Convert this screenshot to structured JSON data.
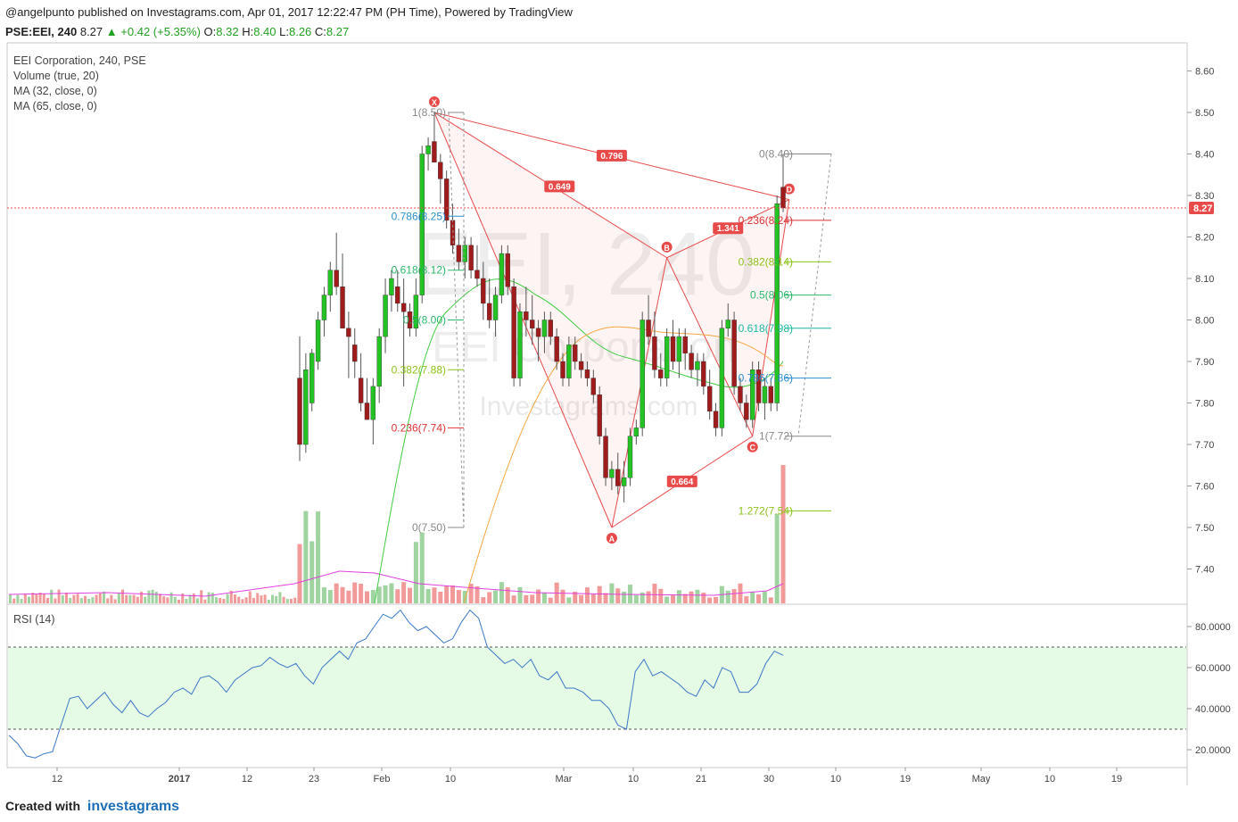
{
  "header": {
    "published": "@angelpunto published on Investagrams.com, Apr 01, 2017 12:22:47 PM (PH Time), Powered by TradingView",
    "symbol": "PSE:EEI, 240",
    "last": "8.27",
    "change": "+0.42 (+5.35%)",
    "o_label": "O:",
    "o": "8.32",
    "h_label": "H:",
    "h": "8.40",
    "l_label": "L:",
    "l": "8.26",
    "c_label": "C:",
    "c": "8.27"
  },
  "legend": {
    "title": "EEI Corporation, 240, PSE",
    "volume": "Volume (true, 20)",
    "ma32": "MA (32, close, 0)",
    "ma65": "MA (65, close, 0)",
    "rsi": "RSI (14)"
  },
  "watermark": {
    "symbol": "EEI, 240",
    "name": "EEI Corporation",
    "site": "Investagrams.com"
  },
  "footer": {
    "created": "Created with",
    "brand": "investagrams"
  },
  "colors": {
    "up": "#22c322",
    "down": "#a01c1c",
    "vol_up": "#9fd39f",
    "vol_down": "#f29a9a",
    "ma32": "#44cc44",
    "ma65": "#f5a742",
    "vol_ma": "#e040e0",
    "pattern": "#e84a4a",
    "rsi": "#3a78c8",
    "rsi_band": "#e6fbe6"
  },
  "chart_data": {
    "type": "candlestick",
    "price_axis": {
      "ticks": [
        "8.60",
        "8.50",
        "8.40",
        "8.30",
        "8.20",
        "8.10",
        "8.00",
        "7.90",
        "7.80",
        "7.70",
        "7.60",
        "7.50",
        "7.40"
      ],
      "range": [
        7.32,
        8.63
      ]
    },
    "last_price_label": "8.27",
    "time_axis": [
      "12",
      "2017",
      "12",
      "23",
      "Feb",
      "10",
      "Mar",
      "10",
      "21",
      "30",
      "10",
      "19",
      "May",
      "10",
      "19"
    ],
    "candles": [
      [
        7.86,
        7.96,
        7.66,
        7.7
      ],
      [
        7.7,
        7.92,
        7.68,
        7.88
      ],
      [
        7.8,
        7.93,
        7.78,
        7.92
      ],
      [
        7.9,
        8.02,
        7.88,
        8.0
      ],
      [
        8.0,
        8.08,
        7.96,
        8.06
      ],
      [
        8.06,
        8.14,
        8.02,
        8.12
      ],
      [
        8.12,
        8.21,
        8.06,
        8.08
      ],
      [
        8.08,
        8.16,
        8.0,
        7.98
      ],
      [
        7.98,
        8.02,
        7.86,
        7.96
      ],
      [
        7.94,
        7.98,
        7.86,
        7.9
      ],
      [
        7.86,
        7.92,
        7.78,
        7.8
      ],
      [
        7.8,
        7.86,
        7.76,
        7.76
      ],
      [
        7.76,
        7.86,
        7.7,
        7.84
      ],
      [
        7.84,
        7.98,
        7.8,
        7.96
      ],
      [
        7.96,
        8.1,
        7.92,
        8.06
      ],
      [
        8.06,
        8.12,
        8.02,
        8.1
      ],
      [
        8.08,
        8.12,
        8.02,
        8.04
      ],
      [
        8.04,
        8.1,
        7.84,
        8.02
      ],
      [
        8.02,
        8.04,
        7.96,
        7.98
      ],
      [
        7.98,
        8.1,
        7.96,
        8.06
      ],
      [
        8.06,
        8.42,
        8.04,
        8.4
      ],
      [
        8.4,
        8.44,
        8.36,
        8.42
      ],
      [
        8.43,
        8.5,
        8.38,
        8.38
      ],
      [
        8.38,
        8.4,
        8.28,
        8.34
      ],
      [
        8.34,
        8.36,
        8.22,
        8.24
      ],
      [
        8.24,
        8.28,
        8.16,
        8.18
      ],
      [
        8.18,
        8.22,
        8.12,
        8.14
      ],
      [
        8.14,
        8.2,
        8.1,
        8.18
      ],
      [
        8.18,
        8.2,
        8.1,
        8.12
      ],
      [
        8.12,
        8.18,
        8.08,
        8.1
      ],
      [
        8.1,
        8.14,
        8.0,
        8.04
      ],
      [
        8.04,
        8.1,
        7.98,
        8.0
      ],
      [
        8.0,
        8.08,
        7.96,
        8.06
      ],
      [
        8.06,
        8.18,
        8.04,
        8.16
      ],
      [
        8.16,
        8.18,
        8.06,
        8.08
      ],
      [
        8.08,
        8.1,
        7.84,
        7.86
      ],
      [
        7.86,
        8.04,
        7.84,
        8.02
      ],
      [
        8.02,
        8.08,
        7.96,
        8.0
      ],
      [
        8.0,
        8.06,
        7.94,
        7.98
      ],
      [
        7.98,
        8.0,
        7.9,
        7.96
      ],
      [
        7.96,
        8.02,
        7.92,
        8.0
      ],
      [
        8.0,
        8.02,
        7.94,
        7.96
      ],
      [
        7.96,
        7.98,
        7.88,
        7.9
      ],
      [
        7.9,
        7.92,
        7.84,
        7.86
      ],
      [
        7.86,
        7.96,
        7.84,
        7.94
      ],
      [
        7.94,
        7.96,
        7.88,
        7.9
      ],
      [
        7.9,
        7.92,
        7.86,
        7.88
      ],
      [
        7.88,
        7.9,
        7.84,
        7.86
      ],
      [
        7.86,
        7.88,
        7.8,
        7.82
      ],
      [
        7.82,
        7.84,
        7.7,
        7.72
      ],
      [
        7.72,
        7.74,
        7.6,
        7.62
      ],
      [
        7.62,
        7.66,
        7.59,
        7.64
      ],
      [
        7.64,
        7.68,
        7.58,
        7.6
      ],
      [
        7.6,
        7.66,
        7.56,
        7.62
      ],
      [
        7.62,
        7.74,
        7.6,
        7.72
      ],
      [
        7.72,
        7.76,
        7.7,
        7.74
      ],
      [
        7.74,
        8.02,
        7.72,
        8.0
      ],
      [
        8.0,
        8.06,
        7.94,
        7.96
      ],
      [
        7.96,
        8.02,
        7.86,
        7.88
      ],
      [
        7.88,
        7.92,
        7.84,
        7.86
      ],
      [
        7.86,
        7.98,
        7.84,
        7.96
      ],
      [
        7.96,
        8.0,
        7.88,
        7.9
      ],
      [
        7.9,
        7.98,
        7.86,
        7.96
      ],
      [
        7.96,
        7.98,
        7.88,
        7.92
      ],
      [
        7.92,
        7.94,
        7.86,
        7.88
      ],
      [
        7.88,
        7.92,
        7.84,
        7.9
      ],
      [
        7.9,
        7.92,
        7.82,
        7.84
      ],
      [
        7.84,
        7.88,
        7.76,
        7.78
      ],
      [
        7.78,
        7.8,
        7.72,
        7.74
      ],
      [
        7.74,
        8.0,
        7.72,
        7.98
      ],
      [
        7.98,
        8.04,
        7.96,
        8.0
      ],
      [
        8.0,
        8.02,
        7.82,
        7.84
      ],
      [
        7.84,
        7.86,
        7.78,
        7.8
      ],
      [
        7.8,
        7.82,
        7.74,
        7.76
      ],
      [
        7.76,
        7.9,
        7.74,
        7.88
      ],
      [
        7.88,
        7.9,
        7.78,
        7.8
      ],
      [
        7.8,
        7.86,
        7.76,
        7.84
      ],
      [
        7.84,
        7.86,
        7.78,
        7.8
      ],
      [
        7.8,
        8.3,
        7.78,
        8.28
      ],
      [
        8.32,
        8.4,
        8.26,
        8.27
      ]
    ],
    "fib_left": [
      {
        "label": "1(8.50)",
        "value": 8.5
      },
      {
        "label": "0.786(8.25)",
        "value": 8.25
      },
      {
        "label": "0.618(8.12)",
        "value": 8.12
      },
      {
        "label": "0.5(8.00)",
        "value": 8.0
      },
      {
        "label": "0.382(7.88)",
        "value": 7.88
      },
      {
        "label": "0.236(7.74)",
        "value": 7.74
      },
      {
        "label": "0(7.50)",
        "value": 7.5
      }
    ],
    "fib_right": [
      {
        "label": "0(8.40)",
        "value": 8.4
      },
      {
        "label": "0.236(8.24)",
        "value": 8.24
      },
      {
        "label": "0.382(8.14)",
        "value": 8.14
      },
      {
        "label": "0.5(8.06)",
        "value": 8.06
      },
      {
        "label": "0.618(7.98)",
        "value": 7.98
      },
      {
        "label": "0.786(7.86)",
        "value": 7.86
      },
      {
        "label": "1(7.72)",
        "value": 7.72
      },
      {
        "label": "1.272(7.54)",
        "value": 7.54
      }
    ],
    "harmonic": {
      "points": [
        {
          "label": "X",
          "bar": 22,
          "value": 8.5
        },
        {
          "label": "A",
          "bar": 51,
          "value": 7.5
        },
        {
          "label": "B",
          "bar": 60,
          "value": 8.15
        },
        {
          "label": "C",
          "bar": 74,
          "value": 7.72
        },
        {
          "label": "D",
          "bar": 80,
          "value": 8.29
        }
      ],
      "ratios": [
        "0.796",
        "0.649",
        "1.341",
        "0.664"
      ]
    },
    "rsi": {
      "ticks": [
        "80.0000",
        "60.0000",
        "40.0000",
        "20.0000"
      ],
      "overbought": 70,
      "oversold": 30,
      "values": [
        27,
        23,
        17,
        16,
        18,
        19,
        32,
        45,
        46,
        40,
        44,
        48,
        42,
        38,
        44,
        38,
        36,
        40,
        43,
        48,
        50,
        47,
        55,
        56,
        53,
        48,
        54,
        57,
        60,
        61,
        65,
        62,
        60,
        62,
        56,
        52,
        60,
        64,
        68,
        64,
        72,
        74,
        80,
        86,
        84,
        88,
        82,
        78,
        80,
        76,
        72,
        74,
        82,
        88,
        84,
        70,
        66,
        62,
        64,
        60,
        64,
        56,
        54,
        58,
        50,
        50,
        48,
        44,
        44,
        40,
        32,
        30,
        58,
        64,
        56,
        58,
        55,
        52,
        48,
        46,
        54,
        50,
        60,
        58,
        48,
        48,
        52,
        62,
        68,
        66
      ]
    }
  }
}
